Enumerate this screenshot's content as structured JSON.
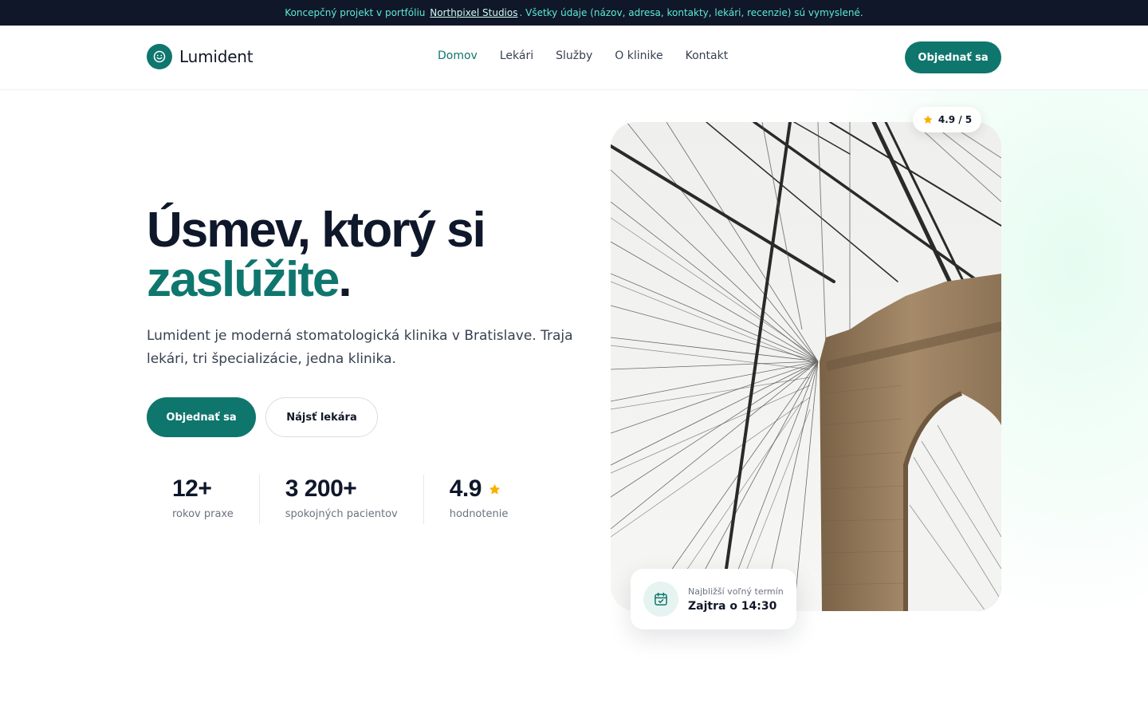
{
  "banner": {
    "text_before": "Koncepčný projekt v portfóliu",
    "link": "Northpixel Studios",
    "text_after": ". Všetky údaje (názov, adresa, kontakty, lekári, recenzie) sú vymyslené."
  },
  "header": {
    "logo_text": "Lumident",
    "nav": [
      "Domov",
      "Lekári",
      "Služby",
      "O klinike",
      "Kontakt"
    ],
    "active_nav": "Domov",
    "cta": "Objednať sa"
  },
  "hero": {
    "title_line1": "Úsmev, ktorý si",
    "title_accent": "zaslúžite",
    "title_period": ".",
    "subtitle": "Lumident je moderná stomatologická klinika v Bratislave. Traja lekári, tri špecializácie, jedna klinika.",
    "primary_button": "Objednať sa",
    "secondary_button": "Nájsť lekára"
  },
  "stats": [
    {
      "value": "12+",
      "label": "rokov praxe"
    },
    {
      "value": "3 200+",
      "label": "spokojných pacientov"
    },
    {
      "value": "4.9",
      "label": "hodnotenie"
    }
  ],
  "rating_badge": "4.9 / 5",
  "next_slot": {
    "label": "Najbližší voľný termín",
    "value": "Zajtra o 14:30"
  },
  "colors": {
    "brand": "#0f766e",
    "banner_bg": "#0f1729",
    "banner_text": "#5eead4",
    "star": "#f5b301",
    "heading": "#0f172a"
  },
  "icons": [
    "smile-icon",
    "star-icon",
    "calendar-check-icon"
  ]
}
